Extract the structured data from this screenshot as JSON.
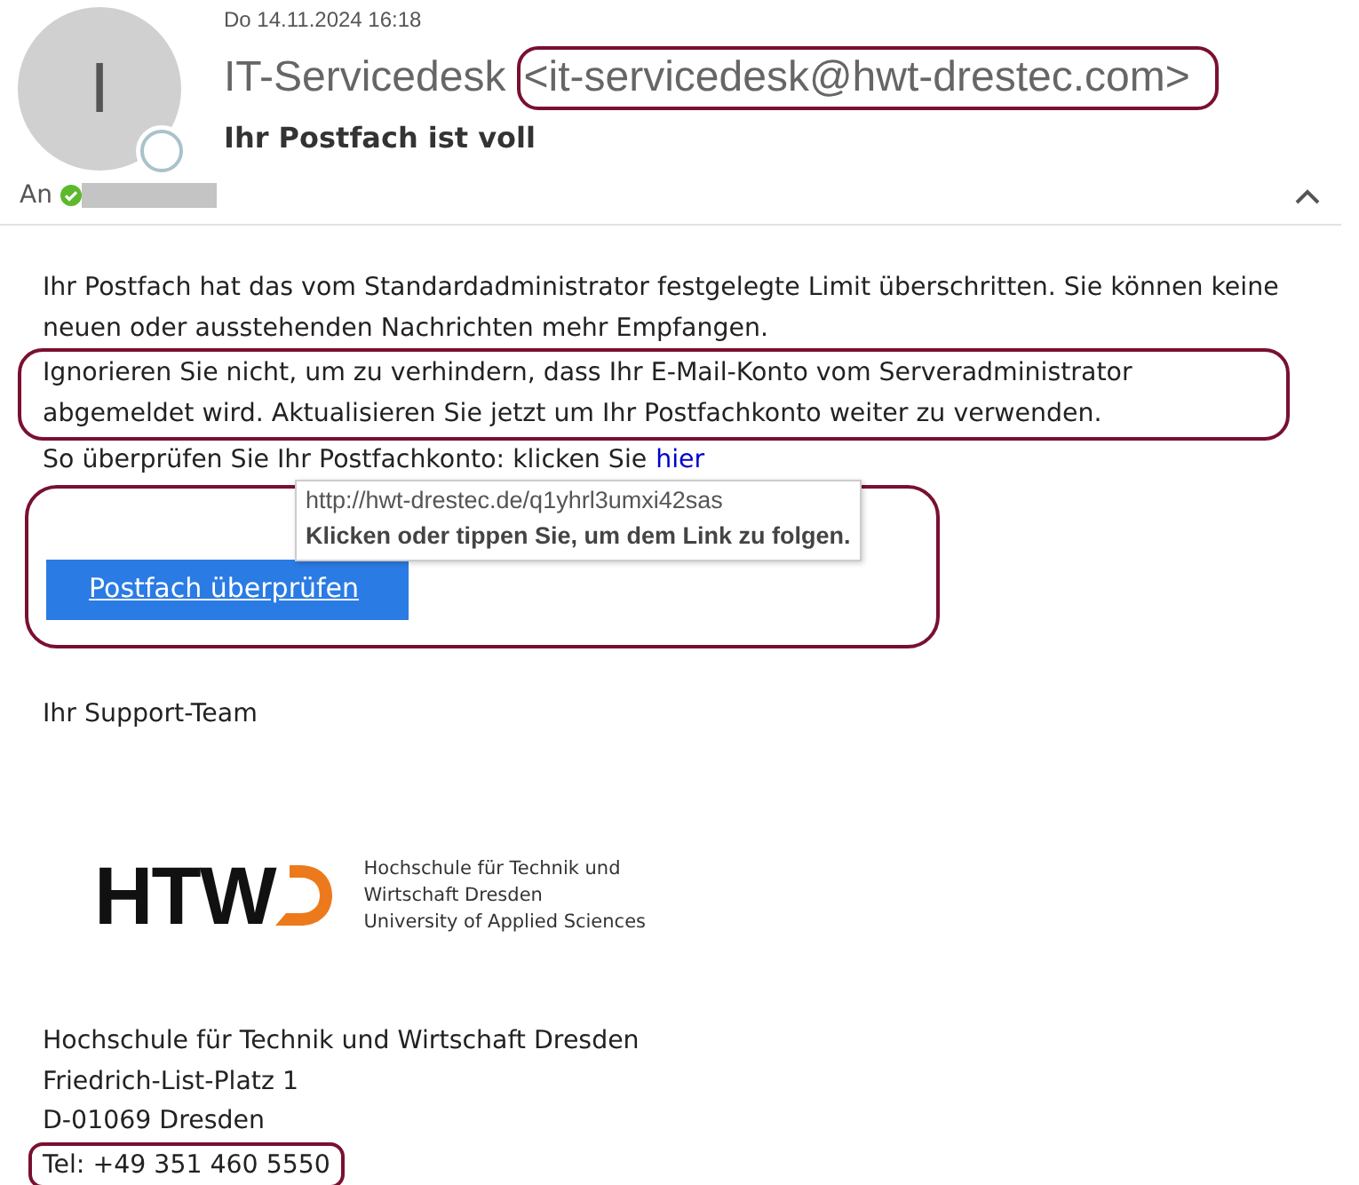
{
  "header": {
    "avatar_initial": "I",
    "date": "Do 14.11.2024 16:18",
    "sender_name": "IT-Servicedesk",
    "sender_address": "<it-servicedesk@hwt-drestec.com>",
    "subject": "Ihr Postfach ist voll",
    "to_label": "An"
  },
  "body": {
    "paragraphs": [
      "Ihr Postfach hat das vom Standardadministrator festgelegte Limit überschritten. Sie können keine neuen oder ausstehenden Nachrichten mehr Empfangen.",
      "Ignorieren Sie nicht, um zu verhindern, dass Ihr E-Mail-Konto vom Serveradministrator abgemeldet wird. Aktualisieren Sie jetzt um Ihr Postfachkonto weiter zu verwenden."
    ],
    "link_sentence": "So überprüfen Sie Ihr Postfachkonto: klicken Sie",
    "link_text": "hier",
    "tooltip": {
      "url": "http://hwt-drestec.de/q1yhrl3umxi42sas",
      "hint": "Klicken oder tippen Sie, um dem Link zu folgen."
    },
    "button": "Postfach überprüfen",
    "signoff": "Ihr Support-Team"
  },
  "logo": {
    "letters": "HTW",
    "lines": [
      "Hochschule für Technik und",
      "Wirtschaft Dresden",
      "University of Applied Sciences"
    ]
  },
  "address": [
    "Hochschule für Technik und Wirtschaft Dresden",
    "Friedrich-List-Platz 1",
    "D-01069 Dresden"
  ],
  "phone": "Tel: +49 351 460 5550"
}
